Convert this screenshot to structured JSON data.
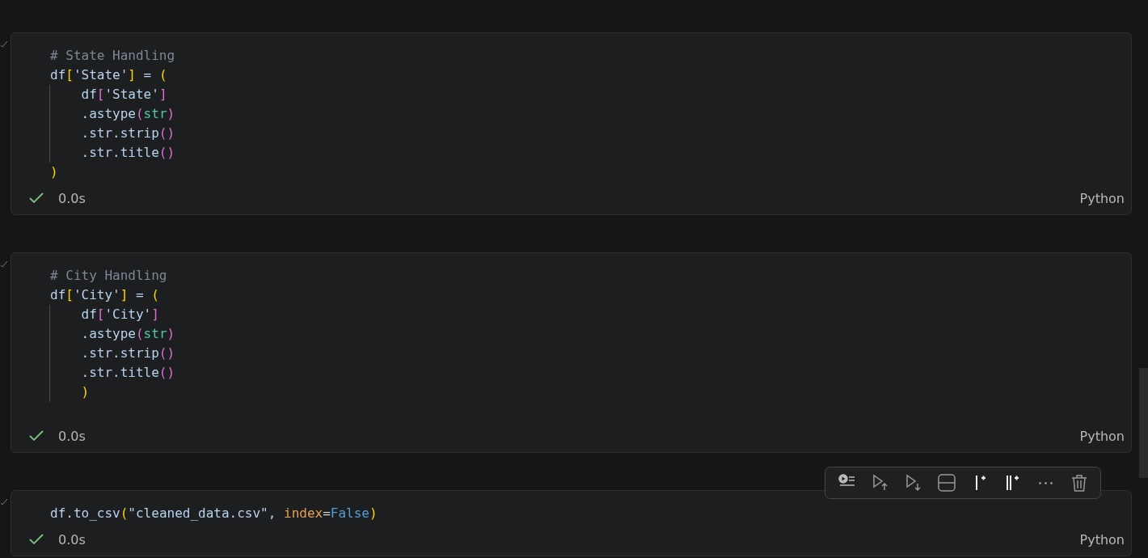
{
  "cells": [
    {
      "lines": [
        {
          "indent_guide": false,
          "tokens": [
            {
              "kind": "comment",
              "text": "# State Handling"
            }
          ]
        },
        {
          "indent_guide": false,
          "tokens": [
            {
              "kind": "plain",
              "text": "df"
            },
            {
              "kind": "bracket1",
              "text": "["
            },
            {
              "kind": "string",
              "text": "'State'"
            },
            {
              "kind": "bracket1",
              "text": "]"
            },
            {
              "kind": "plain",
              "text": " = "
            },
            {
              "kind": "bracket1",
              "text": "("
            }
          ]
        },
        {
          "indent_guide": true,
          "tokens": [
            {
              "kind": "plain",
              "text": "    df"
            },
            {
              "kind": "bracket2",
              "text": "["
            },
            {
              "kind": "string",
              "text": "'State'"
            },
            {
              "kind": "bracket2",
              "text": "]"
            }
          ]
        },
        {
          "indent_guide": true,
          "tokens": [
            {
              "kind": "plain",
              "text": "    .astype"
            },
            {
              "kind": "bracket2",
              "text": "("
            },
            {
              "kind": "builtin",
              "text": "str"
            },
            {
              "kind": "bracket2",
              "text": ")"
            }
          ]
        },
        {
          "indent_guide": true,
          "tokens": [
            {
              "kind": "plain",
              "text": "    .str.strip"
            },
            {
              "kind": "bracket2",
              "text": "()"
            }
          ]
        },
        {
          "indent_guide": true,
          "tokens": [
            {
              "kind": "plain",
              "text": "    .str.title"
            },
            {
              "kind": "bracket2",
              "text": "()"
            }
          ]
        },
        {
          "indent_guide": false,
          "tokens": [
            {
              "kind": "bracket1",
              "text": ")"
            }
          ]
        }
      ],
      "status": "0.0s",
      "language": "Python"
    },
    {
      "lines": [
        {
          "indent_guide": false,
          "tokens": [
            {
              "kind": "comment",
              "text": "# City Handling"
            }
          ]
        },
        {
          "indent_guide": false,
          "tokens": [
            {
              "kind": "plain",
              "text": "df"
            },
            {
              "kind": "bracket1",
              "text": "["
            },
            {
              "kind": "string",
              "text": "'City'"
            },
            {
              "kind": "bracket1",
              "text": "]"
            },
            {
              "kind": "plain",
              "text": " = "
            },
            {
              "kind": "bracket1",
              "text": "("
            }
          ]
        },
        {
          "indent_guide": true,
          "tokens": [
            {
              "kind": "plain",
              "text": "    df"
            },
            {
              "kind": "bracket2",
              "text": "["
            },
            {
              "kind": "string",
              "text": "'City'"
            },
            {
              "kind": "bracket2",
              "text": "]"
            }
          ]
        },
        {
          "indent_guide": true,
          "tokens": [
            {
              "kind": "plain",
              "text": "    .astype"
            },
            {
              "kind": "bracket2",
              "text": "("
            },
            {
              "kind": "builtin",
              "text": "str"
            },
            {
              "kind": "bracket2",
              "text": ")"
            }
          ]
        },
        {
          "indent_guide": true,
          "tokens": [
            {
              "kind": "plain",
              "text": "    .str.strip"
            },
            {
              "kind": "bracket2",
              "text": "()"
            }
          ]
        },
        {
          "indent_guide": true,
          "tokens": [
            {
              "kind": "plain",
              "text": "    .str.title"
            },
            {
              "kind": "bracket2",
              "text": "()"
            }
          ]
        },
        {
          "indent_guide": true,
          "tokens": [
            {
              "kind": "bracket1",
              "text": "    )"
            }
          ]
        }
      ],
      "status": "0.0s",
      "language": "Python"
    },
    {
      "lines": [
        {
          "indent_guide": false,
          "tokens": [
            {
              "kind": "plain",
              "text": "df.to_csv"
            },
            {
              "kind": "bracket1",
              "text": "("
            },
            {
              "kind": "string",
              "text": "\"cleaned_data.csv\""
            },
            {
              "kind": "plain",
              "text": ", "
            },
            {
              "kind": "param",
              "text": "index"
            },
            {
              "kind": "operator",
              "text": "="
            },
            {
              "kind": "constant",
              "text": "False"
            },
            {
              "kind": "bracket1",
              "text": ")"
            }
          ]
        }
      ],
      "status": "0.0s",
      "language": "Python",
      "toolbar": {
        "buttons": [
          {
            "kind": "run-by-line"
          },
          {
            "kind": "run-above"
          },
          {
            "kind": "run-below"
          },
          {
            "kind": "split"
          },
          {
            "kind": "add-cell"
          },
          {
            "kind": "add-cells"
          },
          {
            "kind": "more"
          },
          {
            "kind": "delete"
          }
        ]
      }
    }
  ]
}
